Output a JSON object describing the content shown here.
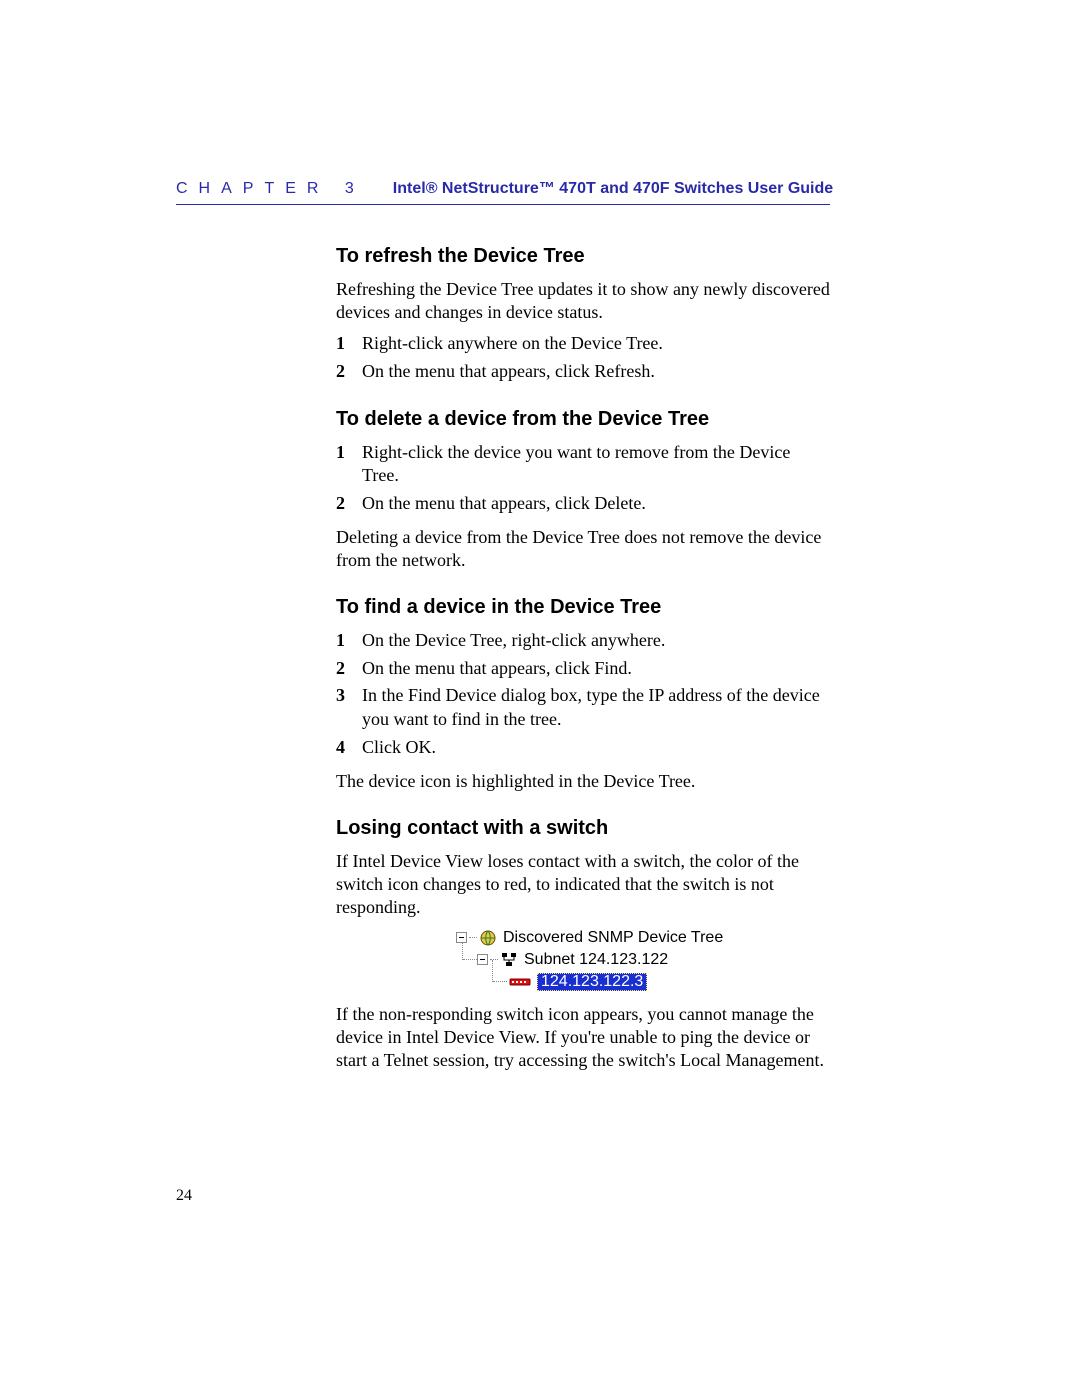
{
  "header": {
    "chapter": "CHAPTER 3",
    "title": "Intel® NetStructure™ 470T and 470F Switches User Guide"
  },
  "sections": [
    {
      "heading": "To refresh the Device Tree",
      "intro": "Refreshing the Device Tree updates it to show any newly discovered devices and changes in device status.",
      "steps": [
        "Right-click anywhere on the Device Tree.",
        "On the menu that appears, click Refresh."
      ]
    },
    {
      "heading": "To delete a device from the Device Tree",
      "steps": [
        "Right-click the device you want to remove from the Device Tree.",
        "On the menu that appears, click Delete."
      ],
      "after": "Deleting a device from the Device Tree does not remove the device from the network."
    },
    {
      "heading": "To find a device in the Device Tree",
      "steps": [
        "On the Device Tree, right-click anywhere.",
        "On the menu that appears, click Find.",
        "In the Find Device dialog box, type the IP address of the device you want to find in the tree.",
        "Click OK."
      ],
      "after": "The device icon is highlighted in the Device Tree."
    },
    {
      "heading": "Losing contact with a switch",
      "intro": "If Intel Device View loses contact with a switch, the color of the switch icon changes to red, to indicated that the switch is not responding.",
      "tree": {
        "root_label": "Discovered SNMP Device Tree",
        "subnet_label": "Subnet 124.123.122",
        "device_label": "124.123.122.3"
      },
      "after": "If the non-responding switch icon appears, you cannot manage the device in Intel Device View. If you're unable to ping the device or start a Telnet session, try accessing the switch's Local Management."
    }
  ],
  "page_number": "24"
}
